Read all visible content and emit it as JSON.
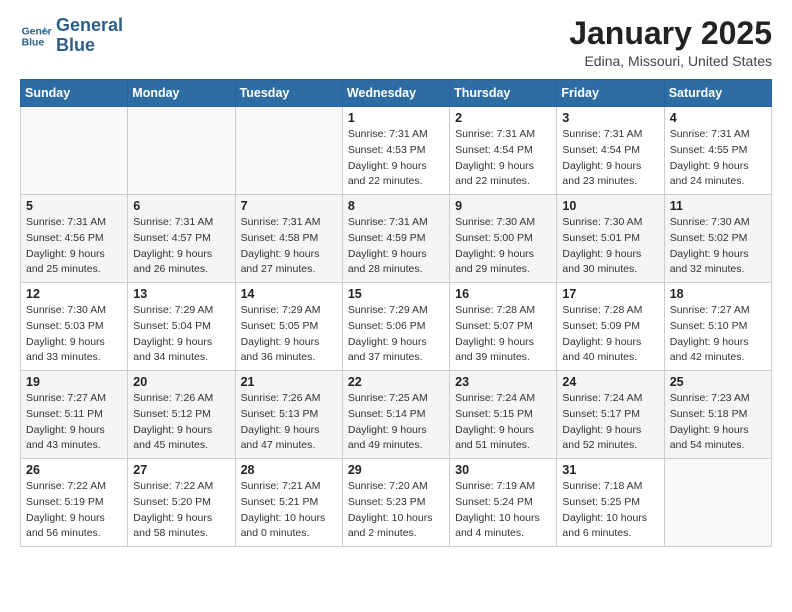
{
  "header": {
    "logo_line1": "General",
    "logo_line2": "Blue",
    "month_title": "January 2025",
    "location": "Edina, Missouri, United States"
  },
  "weekdays": [
    "Sunday",
    "Monday",
    "Tuesday",
    "Wednesday",
    "Thursday",
    "Friday",
    "Saturday"
  ],
  "weeks": [
    [
      {
        "day": "",
        "sunrise": "",
        "sunset": "",
        "daylight": "",
        "empty": true
      },
      {
        "day": "",
        "sunrise": "",
        "sunset": "",
        "daylight": "",
        "empty": true
      },
      {
        "day": "",
        "sunrise": "",
        "sunset": "",
        "daylight": "",
        "empty": true
      },
      {
        "day": "1",
        "sunrise": "Sunrise: 7:31 AM",
        "sunset": "Sunset: 4:53 PM",
        "daylight": "Daylight: 9 hours and 22 minutes.",
        "empty": false
      },
      {
        "day": "2",
        "sunrise": "Sunrise: 7:31 AM",
        "sunset": "Sunset: 4:54 PM",
        "daylight": "Daylight: 9 hours and 22 minutes.",
        "empty": false
      },
      {
        "day": "3",
        "sunrise": "Sunrise: 7:31 AM",
        "sunset": "Sunset: 4:54 PM",
        "daylight": "Daylight: 9 hours and 23 minutes.",
        "empty": false
      },
      {
        "day": "4",
        "sunrise": "Sunrise: 7:31 AM",
        "sunset": "Sunset: 4:55 PM",
        "daylight": "Daylight: 9 hours and 24 minutes.",
        "empty": false
      }
    ],
    [
      {
        "day": "5",
        "sunrise": "Sunrise: 7:31 AM",
        "sunset": "Sunset: 4:56 PM",
        "daylight": "Daylight: 9 hours and 25 minutes.",
        "empty": false
      },
      {
        "day": "6",
        "sunrise": "Sunrise: 7:31 AM",
        "sunset": "Sunset: 4:57 PM",
        "daylight": "Daylight: 9 hours and 26 minutes.",
        "empty": false
      },
      {
        "day": "7",
        "sunrise": "Sunrise: 7:31 AM",
        "sunset": "Sunset: 4:58 PM",
        "daylight": "Daylight: 9 hours and 27 minutes.",
        "empty": false
      },
      {
        "day": "8",
        "sunrise": "Sunrise: 7:31 AM",
        "sunset": "Sunset: 4:59 PM",
        "daylight": "Daylight: 9 hours and 28 minutes.",
        "empty": false
      },
      {
        "day": "9",
        "sunrise": "Sunrise: 7:30 AM",
        "sunset": "Sunset: 5:00 PM",
        "daylight": "Daylight: 9 hours and 29 minutes.",
        "empty": false
      },
      {
        "day": "10",
        "sunrise": "Sunrise: 7:30 AM",
        "sunset": "Sunset: 5:01 PM",
        "daylight": "Daylight: 9 hours and 30 minutes.",
        "empty": false
      },
      {
        "day": "11",
        "sunrise": "Sunrise: 7:30 AM",
        "sunset": "Sunset: 5:02 PM",
        "daylight": "Daylight: 9 hours and 32 minutes.",
        "empty": false
      }
    ],
    [
      {
        "day": "12",
        "sunrise": "Sunrise: 7:30 AM",
        "sunset": "Sunset: 5:03 PM",
        "daylight": "Daylight: 9 hours and 33 minutes.",
        "empty": false
      },
      {
        "day": "13",
        "sunrise": "Sunrise: 7:29 AM",
        "sunset": "Sunset: 5:04 PM",
        "daylight": "Daylight: 9 hours and 34 minutes.",
        "empty": false
      },
      {
        "day": "14",
        "sunrise": "Sunrise: 7:29 AM",
        "sunset": "Sunset: 5:05 PM",
        "daylight": "Daylight: 9 hours and 36 minutes.",
        "empty": false
      },
      {
        "day": "15",
        "sunrise": "Sunrise: 7:29 AM",
        "sunset": "Sunset: 5:06 PM",
        "daylight": "Daylight: 9 hours and 37 minutes.",
        "empty": false
      },
      {
        "day": "16",
        "sunrise": "Sunrise: 7:28 AM",
        "sunset": "Sunset: 5:07 PM",
        "daylight": "Daylight: 9 hours and 39 minutes.",
        "empty": false
      },
      {
        "day": "17",
        "sunrise": "Sunrise: 7:28 AM",
        "sunset": "Sunset: 5:09 PM",
        "daylight": "Daylight: 9 hours and 40 minutes.",
        "empty": false
      },
      {
        "day": "18",
        "sunrise": "Sunrise: 7:27 AM",
        "sunset": "Sunset: 5:10 PM",
        "daylight": "Daylight: 9 hours and 42 minutes.",
        "empty": false
      }
    ],
    [
      {
        "day": "19",
        "sunrise": "Sunrise: 7:27 AM",
        "sunset": "Sunset: 5:11 PM",
        "daylight": "Daylight: 9 hours and 43 minutes.",
        "empty": false
      },
      {
        "day": "20",
        "sunrise": "Sunrise: 7:26 AM",
        "sunset": "Sunset: 5:12 PM",
        "daylight": "Daylight: 9 hours and 45 minutes.",
        "empty": false
      },
      {
        "day": "21",
        "sunrise": "Sunrise: 7:26 AM",
        "sunset": "Sunset: 5:13 PM",
        "daylight": "Daylight: 9 hours and 47 minutes.",
        "empty": false
      },
      {
        "day": "22",
        "sunrise": "Sunrise: 7:25 AM",
        "sunset": "Sunset: 5:14 PM",
        "daylight": "Daylight: 9 hours and 49 minutes.",
        "empty": false
      },
      {
        "day": "23",
        "sunrise": "Sunrise: 7:24 AM",
        "sunset": "Sunset: 5:15 PM",
        "daylight": "Daylight: 9 hours and 51 minutes.",
        "empty": false
      },
      {
        "day": "24",
        "sunrise": "Sunrise: 7:24 AM",
        "sunset": "Sunset: 5:17 PM",
        "daylight": "Daylight: 9 hours and 52 minutes.",
        "empty": false
      },
      {
        "day": "25",
        "sunrise": "Sunrise: 7:23 AM",
        "sunset": "Sunset: 5:18 PM",
        "daylight": "Daylight: 9 hours and 54 minutes.",
        "empty": false
      }
    ],
    [
      {
        "day": "26",
        "sunrise": "Sunrise: 7:22 AM",
        "sunset": "Sunset: 5:19 PM",
        "daylight": "Daylight: 9 hours and 56 minutes.",
        "empty": false
      },
      {
        "day": "27",
        "sunrise": "Sunrise: 7:22 AM",
        "sunset": "Sunset: 5:20 PM",
        "daylight": "Daylight: 9 hours and 58 minutes.",
        "empty": false
      },
      {
        "day": "28",
        "sunrise": "Sunrise: 7:21 AM",
        "sunset": "Sunset: 5:21 PM",
        "daylight": "Daylight: 10 hours and 0 minutes.",
        "empty": false
      },
      {
        "day": "29",
        "sunrise": "Sunrise: 7:20 AM",
        "sunset": "Sunset: 5:23 PM",
        "daylight": "Daylight: 10 hours and 2 minutes.",
        "empty": false
      },
      {
        "day": "30",
        "sunrise": "Sunrise: 7:19 AM",
        "sunset": "Sunset: 5:24 PM",
        "daylight": "Daylight: 10 hours and 4 minutes.",
        "empty": false
      },
      {
        "day": "31",
        "sunrise": "Sunrise: 7:18 AM",
        "sunset": "Sunset: 5:25 PM",
        "daylight": "Daylight: 10 hours and 6 minutes.",
        "empty": false
      },
      {
        "day": "",
        "sunrise": "",
        "sunset": "",
        "daylight": "",
        "empty": true
      }
    ]
  ]
}
